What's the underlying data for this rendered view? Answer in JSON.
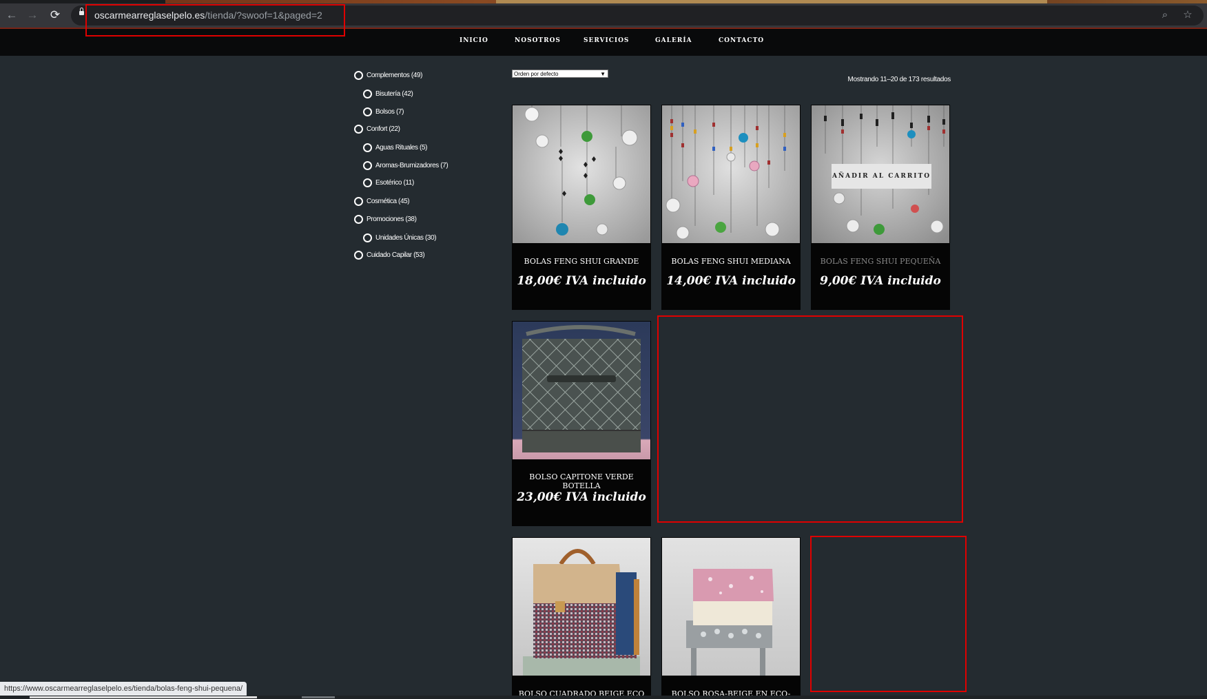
{
  "browser": {
    "url_domain": "oscarmearreglaselpelo.es",
    "url_path": "/tienda/?swoof=1&paged=2",
    "status_url": "https://www.oscarmearreglaselpelo.es/tienda/bolas-feng-shui-pequena/",
    "back_icon": "←",
    "forward_icon": "→",
    "reload_icon": "⟳",
    "zoom_icon": "⌕",
    "star_icon": "☆"
  },
  "nav": {
    "items": [
      "INICIO",
      "NOSOTROS",
      "SERVICIOS",
      "GALERÍA",
      "CONTACTO"
    ]
  },
  "filters": [
    {
      "label": "Complementos (49)",
      "level": 0
    },
    {
      "label": "Bisutería (42)",
      "level": 1
    },
    {
      "label": "Bolsos (7)",
      "level": 1
    },
    {
      "label": "Confort (22)",
      "level": 0
    },
    {
      "label": "Aguas Rituales (5)",
      "level": 1
    },
    {
      "label": "Aromas-Brumizadores (7)",
      "level": 1
    },
    {
      "label": "Esotérico (11)",
      "level": 1
    },
    {
      "label": "Cosmética (45)",
      "level": 0
    },
    {
      "label": "Promociones (38)",
      "level": 0
    },
    {
      "label": "Unidades Únicas (30)",
      "level": 1
    },
    {
      "label": "Cuidado Capilar (53)",
      "level": 0
    }
  ],
  "shop": {
    "sort_value": "Orden por defecto",
    "result_count": "Mostrando 11–20 de 173 resultados",
    "add_to_cart": "AÑADIR AL CARRITO"
  },
  "products": [
    {
      "name": "BOLAS FENG SHUI GRANDE",
      "price": "18,00€ IVA incluido"
    },
    {
      "name": "BOLAS FENG SHUI MEDIANA",
      "price": "14,00€ IVA incluido"
    },
    {
      "name": "BOLAS FENG SHUI PEQUEÑA",
      "price": "9,00€ IVA incluido"
    },
    {
      "name": "BOLSO CAPITONE VERDE BOTELLA",
      "price": "23,00€ IVA incluido"
    },
    {
      "name": "BOLSO CUADRADO BEIGE ECO",
      "price": ""
    },
    {
      "name": "BOLSO ROSA-BEIGE EN ECO-",
      "price": ""
    }
  ],
  "colors": {
    "page_bg": "#242b30",
    "nav_bg": "#090a0b",
    "card_bg": "#050505",
    "annotation": "#e00000"
  }
}
